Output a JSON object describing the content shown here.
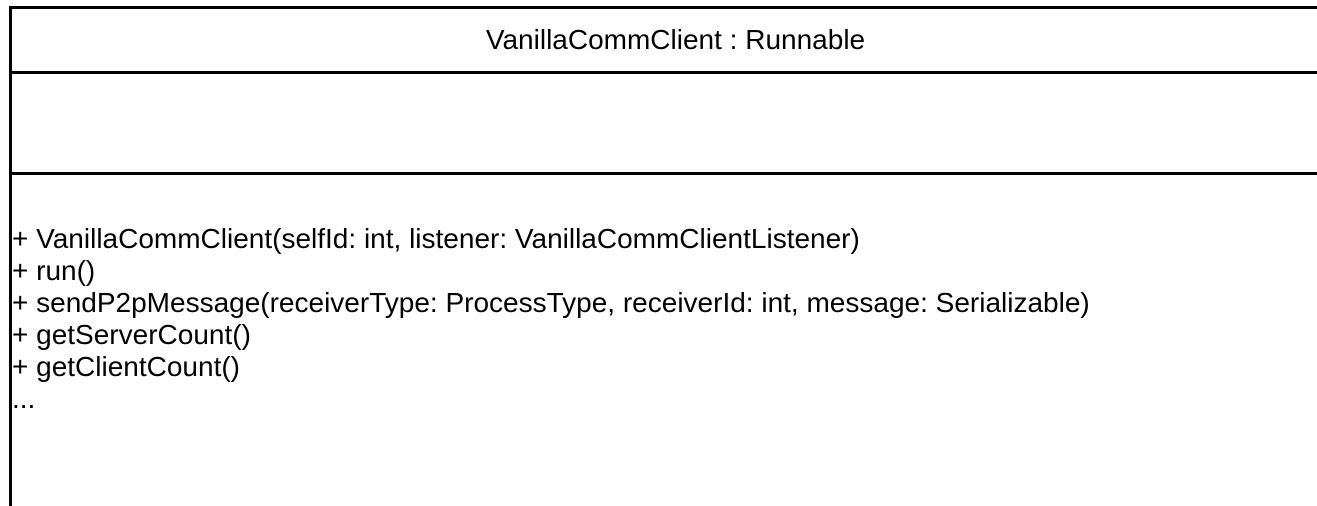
{
  "class": {
    "title": "VanillaCommClient : Runnable",
    "attributes": [],
    "operations": [
      "+ VanillaCommClient(selfId: int, listener: VanillaCommClientListener)",
      "+ run()",
      "+ sendP2pMessage(receiverType: ProcessType, receiverId: int, message: Serializable)",
      "+ getServerCount()",
      "+ getClientCount()",
      "..."
    ]
  }
}
